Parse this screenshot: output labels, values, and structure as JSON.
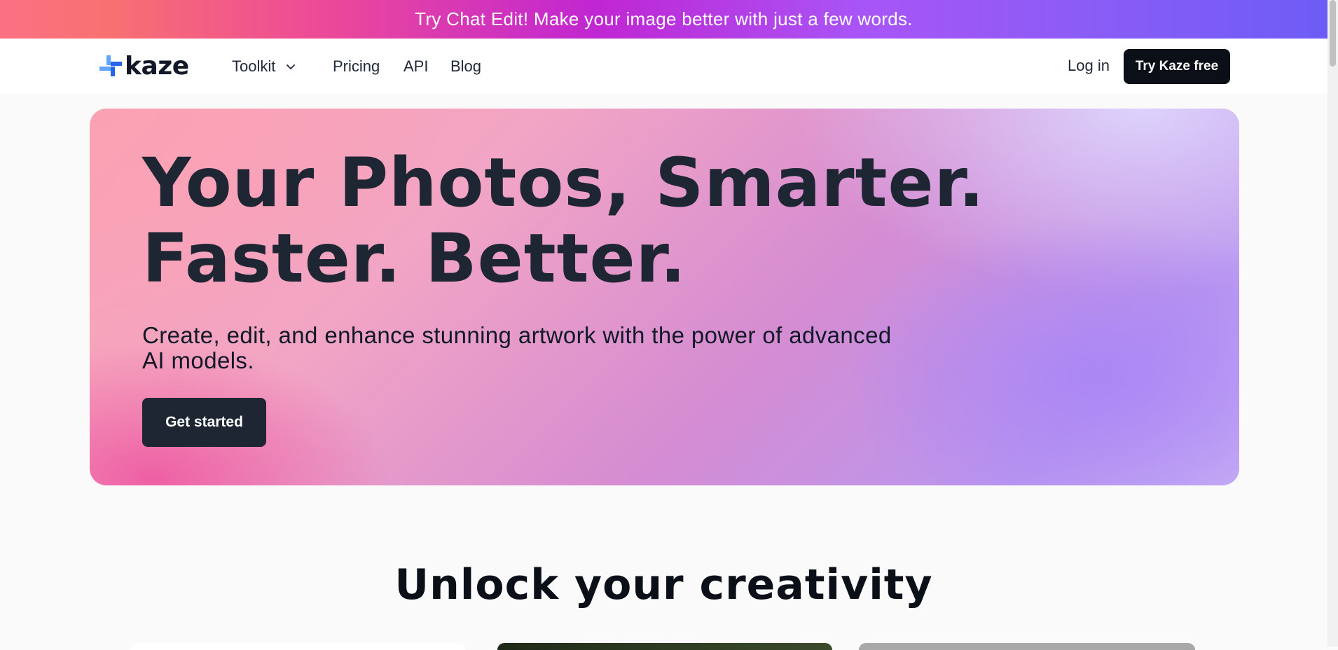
{
  "promo": {
    "text": "Try Chat Edit! Make your image better with just a few words."
  },
  "brand": {
    "name": "kaze",
    "colors": {
      "logo_blue_dark": "#2563eb",
      "logo_blue_light": "#60a5fa"
    }
  },
  "nav": {
    "items": [
      {
        "label": "Toolkit",
        "has_dropdown": true,
        "icon": "chevron-down-icon"
      },
      {
        "label": "Pricing"
      },
      {
        "label": "API"
      },
      {
        "label": "Blog"
      }
    ],
    "login_label": "Log in",
    "cta_label": "Try Kaze free"
  },
  "hero": {
    "title": "Your Photos, Smarter. Faster. Better.",
    "subtitle": "Create, edit, and enhance stunning artwork with the power of advanced AI models.",
    "cta_label": "Get started"
  },
  "section": {
    "title": "Unlock your creativity"
  },
  "colors": {
    "dark": "#1e2533",
    "black": "#0b0f17",
    "page_bg": "#fafafa"
  }
}
